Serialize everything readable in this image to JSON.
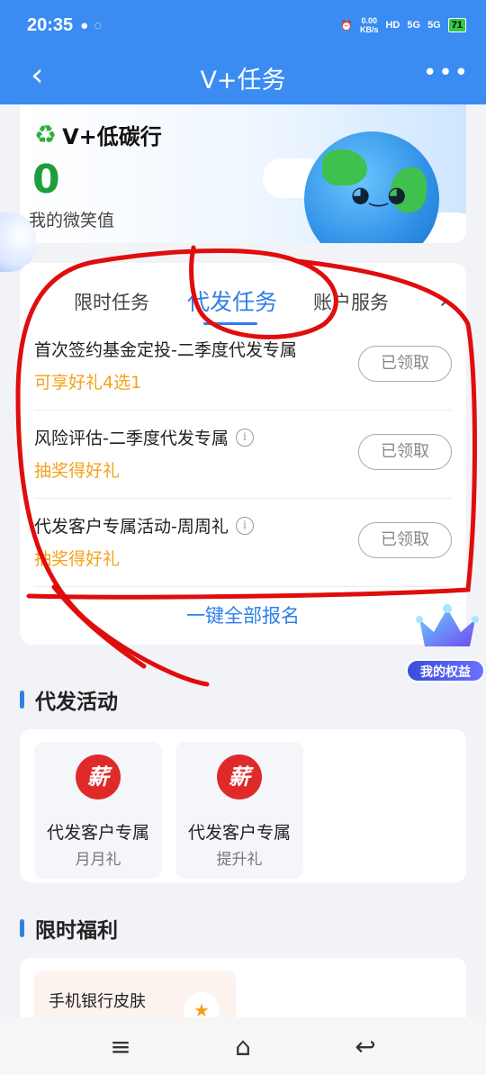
{
  "status_bar": {
    "time": "20:35",
    "speed_value": "0.00",
    "speed_unit": "KB/s",
    "hd": "HD",
    "net1": "5G",
    "net2": "5G",
    "battery": "71"
  },
  "nav": {
    "back": "‹",
    "title": "V+任务",
    "more": "•••"
  },
  "hero": {
    "brand": "V+低碳行",
    "score": "0",
    "score_label": "我的微笑值"
  },
  "tabs": [
    {
      "label": "限时任务"
    },
    {
      "label": "代发任务"
    },
    {
      "label": "账户服务"
    }
  ],
  "tab_next": "›",
  "tasks": [
    {
      "name": "首次签约基金定投-二季度代发专属",
      "reward": "可享好礼4选1",
      "button": "已领取"
    },
    {
      "name": "风险评估-二季度代发专属",
      "reward": "抽奖得好礼",
      "button": "已领取"
    },
    {
      "name": "代发客户专属活动-周周礼",
      "reward": "抽奖得好礼",
      "button": "已领取"
    }
  ],
  "enroll_all": "一键全部报名",
  "rights_badge": "我的权益",
  "activity_section": "代发活动",
  "activities": [
    {
      "icon_char": "薪",
      "title": "代发客户专属",
      "subtitle": "月月礼"
    },
    {
      "icon_char": "薪",
      "title": "代发客户专属",
      "subtitle": "提升礼"
    }
  ],
  "welfare_section": "限时福利",
  "welfare_items": [
    {
      "title": "手机银行皮肤"
    }
  ],
  "colors": {
    "primary": "#3a8cf3",
    "accent_blue": "#2f7fe9",
    "reward_orange": "#f3a21a",
    "score_green": "#1e9e3a"
  }
}
